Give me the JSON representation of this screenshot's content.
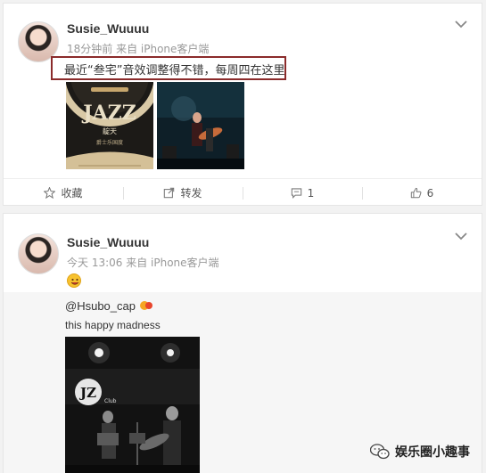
{
  "posts": [
    {
      "username": "Susie_Wuuuu",
      "meta": "18分钟前 来自 iPhone客户端",
      "text": "最近“叁宅”音效调整得不错，每周四在这里",
      "images": [
        {
          "icon": "jazz-poster-image",
          "title": "JAZZ",
          "subtitle": "靛天",
          "note": "爵士乐国度"
        },
        {
          "icon": "stage-performance-image"
        }
      ],
      "actions": {
        "collect_label": "收藏",
        "repost_label": "转发",
        "comment_count": "1",
        "like_count": "6"
      }
    },
    {
      "username": "Susie_Wuuuu",
      "meta": "今天 13:06 来自 iPhone客户端",
      "emoji": "grinning-face-icon",
      "repost": {
        "user": "@Hsubo_cap",
        "text": "this happy madness",
        "image": {
          "icon": "jz-club-photo",
          "label": "Club"
        }
      }
    }
  ],
  "watermark": {
    "text": "娱乐圈小趣事",
    "icon": "wechat-icon"
  },
  "colors": {
    "highlight_border": "#8b2b2b",
    "muted_text": "#999999",
    "card_bg": "#ffffff",
    "page_bg": "#f2f2f2"
  }
}
